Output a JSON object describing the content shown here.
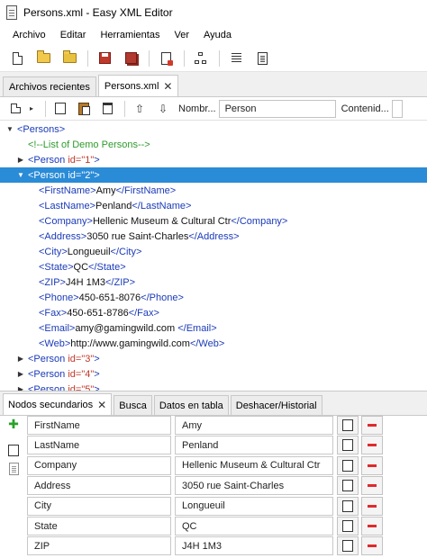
{
  "window": {
    "title": "Persons.xml - Easy XML Editor"
  },
  "menu": [
    "Archivo",
    "Editar",
    "Herramientas",
    "Ver",
    "Ayuda"
  ],
  "toolbar": {
    "icons": [
      "new-document-icon",
      "open-folder-icon",
      "open-folder-alt-icon",
      "save-icon",
      "save-all-icon",
      "export-icon",
      "tree-view-icon",
      "indent-icon",
      "text-view-icon"
    ]
  },
  "doc_tabs": [
    {
      "label": "Archivos recientes",
      "active": false
    },
    {
      "label": "Persons.xml",
      "active": true,
      "close": "✕"
    }
  ],
  "tree_toolbar": {
    "name_label": "Nombr...",
    "name_value": "Person",
    "content_label": "Contenid..."
  },
  "tree": [
    {
      "depth": 0,
      "arrow": "▼",
      "parts": [
        [
          "tag",
          "<Persons>"
        ]
      ]
    },
    {
      "depth": 1,
      "arrow": "",
      "parts": [
        [
          "comment",
          "<!--List of Demo Persons-->"
        ]
      ]
    },
    {
      "depth": 1,
      "arrow": "▶",
      "parts": [
        [
          "tag",
          "<Person "
        ],
        [
          "attr",
          "id=\"1\""
        ],
        [
          "tag",
          ">"
        ]
      ]
    },
    {
      "depth": 1,
      "arrow": "▼",
      "selected": true,
      "parts": [
        [
          "tag",
          "<Person "
        ],
        [
          "attr",
          "id=\"2\""
        ],
        [
          "tag",
          ">"
        ]
      ]
    },
    {
      "depth": 2,
      "arrow": "",
      "parts": [
        [
          "tag",
          "<FirstName>"
        ],
        [
          "text",
          "Amy"
        ],
        [
          "tag",
          "</FirstName>"
        ]
      ]
    },
    {
      "depth": 2,
      "arrow": "",
      "parts": [
        [
          "tag",
          "<LastName>"
        ],
        [
          "text",
          "Penland"
        ],
        [
          "tag",
          "</LastName>"
        ]
      ]
    },
    {
      "depth": 2,
      "arrow": "",
      "parts": [
        [
          "tag",
          "<Company>"
        ],
        [
          "text",
          "Hellenic Museum & Cultural Ctr"
        ],
        [
          "tag",
          "</Company>"
        ]
      ]
    },
    {
      "depth": 2,
      "arrow": "",
      "parts": [
        [
          "tag",
          "<Address>"
        ],
        [
          "text",
          "3050 rue Saint-Charles"
        ],
        [
          "tag",
          "</Address>"
        ]
      ]
    },
    {
      "depth": 2,
      "arrow": "",
      "parts": [
        [
          "tag",
          "<City>"
        ],
        [
          "text",
          "Longueuil"
        ],
        [
          "tag",
          "</City>"
        ]
      ]
    },
    {
      "depth": 2,
      "arrow": "",
      "parts": [
        [
          "tag",
          "<State>"
        ],
        [
          "text",
          "QC"
        ],
        [
          "tag",
          "</State>"
        ]
      ]
    },
    {
      "depth": 2,
      "arrow": "",
      "parts": [
        [
          "tag",
          "<ZIP>"
        ],
        [
          "text",
          "J4H 1M3"
        ],
        [
          "tag",
          "</ZIP>"
        ]
      ]
    },
    {
      "depth": 2,
      "arrow": "",
      "parts": [
        [
          "tag",
          "<Phone>"
        ],
        [
          "text",
          "450-651-8076"
        ],
        [
          "tag",
          "</Phone>"
        ]
      ]
    },
    {
      "depth": 2,
      "arrow": "",
      "parts": [
        [
          "tag",
          "<Fax>"
        ],
        [
          "text",
          "450-651-8786"
        ],
        [
          "tag",
          "</Fax>"
        ]
      ]
    },
    {
      "depth": 2,
      "arrow": "",
      "parts": [
        [
          "tag",
          "<Email>"
        ],
        [
          "text",
          "amy@gamingwild.com "
        ],
        [
          "tag",
          "</Email>"
        ]
      ]
    },
    {
      "depth": 2,
      "arrow": "",
      "parts": [
        [
          "tag",
          "<Web>"
        ],
        [
          "text",
          "http://www.gamingwild.com"
        ],
        [
          "tag",
          "</Web>"
        ]
      ]
    },
    {
      "depth": 1,
      "arrow": "▶",
      "parts": [
        [
          "tag",
          "<Person "
        ],
        [
          "attr",
          "id=\"3\""
        ],
        [
          "tag",
          ">"
        ]
      ]
    },
    {
      "depth": 1,
      "arrow": "▶",
      "parts": [
        [
          "tag",
          "<Person "
        ],
        [
          "attr",
          "id=\"4\""
        ],
        [
          "tag",
          ">"
        ]
      ]
    },
    {
      "depth": 1,
      "arrow": "▶",
      "parts": [
        [
          "tag",
          "<Person "
        ],
        [
          "attr",
          "id=\"5\""
        ],
        [
          "tag",
          ">"
        ]
      ]
    }
  ],
  "bottom_tabs": [
    {
      "label": "Nodos secundarios",
      "active": true,
      "close": "✕"
    },
    {
      "label": "Busca",
      "active": false
    },
    {
      "label": "Datos en tabla",
      "active": false
    },
    {
      "label": "Deshacer/Historial",
      "active": false
    }
  ],
  "child_nodes": [
    {
      "name": "FirstName",
      "value": "Amy"
    },
    {
      "name": "LastName",
      "value": "Penland"
    },
    {
      "name": "Company",
      "value": "Hellenic Museum & Cultural Ctr"
    },
    {
      "name": "Address",
      "value": "3050 rue Saint-Charles"
    },
    {
      "name": "City",
      "value": "Longueuil"
    },
    {
      "name": "State",
      "value": "QC"
    },
    {
      "name": "ZIP",
      "value": "J4H 1M3"
    }
  ],
  "colors": {
    "selection": "#2a8bd6",
    "tag": "#1a3ab8",
    "attribute": "#c0392b",
    "comment": "#2e9b2e",
    "add": "#2aa12a",
    "remove": "#e02a2a"
  }
}
